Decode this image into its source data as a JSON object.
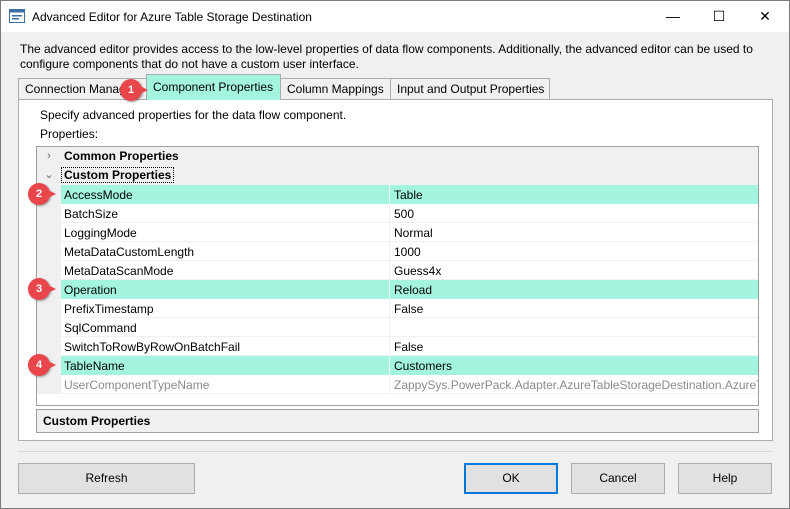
{
  "window": {
    "title": "Advanced Editor for Azure Table Storage Destination",
    "minimize_glyph": "—",
    "maximize_glyph": "☐",
    "close_glyph": "✕"
  },
  "description": "The advanced editor provides access to the low-level properties of data flow components. Additionally, the advanced editor can be used to configure components that do not have a custom user interface.",
  "tabs": [
    {
      "label": "Connection Managers",
      "active": false
    },
    {
      "label": "Component Properties",
      "active": true
    },
    {
      "label": "Column Mappings",
      "active": false
    },
    {
      "label": "Input and Output Properties",
      "active": false
    }
  ],
  "panel": {
    "specify_text": "Specify advanced properties for the data flow component.",
    "properties_label": "Properties:"
  },
  "grid": {
    "categories": [
      {
        "name": "Common Properties",
        "expanded": false,
        "chevron": "›"
      },
      {
        "name": "Custom Properties",
        "expanded": true,
        "chevron": "⌄"
      }
    ],
    "rows": [
      {
        "name": "AccessMode",
        "value": "Table",
        "highlighted": true
      },
      {
        "name": "BatchSize",
        "value": "500",
        "highlighted": false
      },
      {
        "name": "LoggingMode",
        "value": "Normal",
        "highlighted": false
      },
      {
        "name": "MetaDataCustomLength",
        "value": "1000",
        "highlighted": false
      },
      {
        "name": "MetaDataScanMode",
        "value": "Guess4x",
        "highlighted": false
      },
      {
        "name": "Operation",
        "value": "Reload",
        "highlighted": true
      },
      {
        "name": "PrefixTimestamp",
        "value": "False",
        "highlighted": false
      },
      {
        "name": "SqlCommand",
        "value": "",
        "highlighted": false
      },
      {
        "name": "SwitchToRowByRowOnBatchFail",
        "value": "False",
        "highlighted": false
      },
      {
        "name": "TableName",
        "value": "Customers",
        "highlighted": true
      },
      {
        "name": "UserComponentTypeName",
        "value": "ZappySys.PowerPack.Adapter.AzureTableStorageDestination.AzureTableStorageDestination",
        "highlighted": false,
        "disabled": true
      }
    ]
  },
  "description_pane": {
    "title": "Custom Properties"
  },
  "buttons": {
    "refresh": "Refresh",
    "ok": "OK",
    "cancel": "Cancel",
    "help": "Help"
  },
  "badges": [
    "1",
    "2",
    "3",
    "4"
  ],
  "colors": {
    "highlight": "#a3f5df",
    "badge": "#e8464a",
    "focus_border": "#0078d7"
  }
}
